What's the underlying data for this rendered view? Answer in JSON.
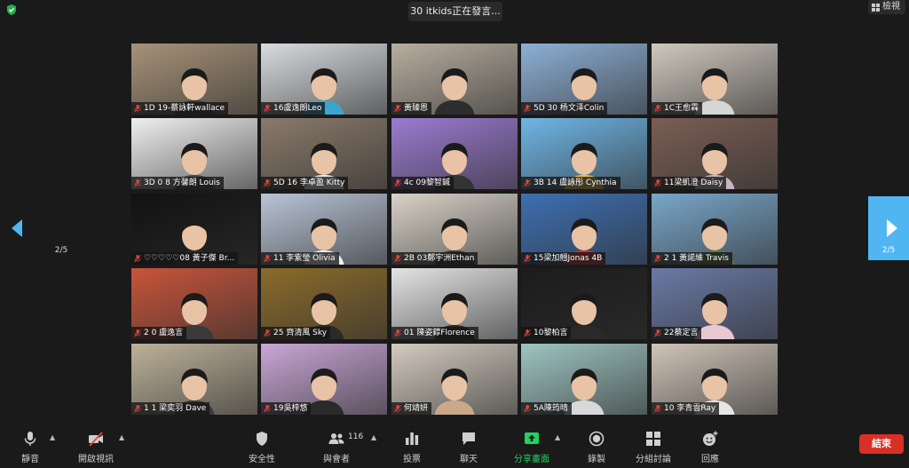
{
  "top": {
    "speaker_banner": "30 itkids正在發言...",
    "view_label": "檢視"
  },
  "pager": {
    "left": "2/5",
    "right": "2/5"
  },
  "colors": {
    "accent_blue": "#4fb6f2",
    "end_red": "#d93025",
    "share_green": "#23d160",
    "mic_muted": "#e5463b"
  },
  "tiles": [
    {
      "name": "1D 19-蔡詠軒wallace",
      "scene": "#a79278",
      "shirt": "#3a3a3a"
    },
    {
      "name": "16盧逸朗Leo",
      "scene": "#d9dce0",
      "shirt": "#39a6cf"
    },
    {
      "name": "黃臻恩",
      "scene": "#b8aea0",
      "shirt": "#2d2d2d"
    },
    {
      "name": "5D 30 杨文泽Colin",
      "scene": "#8db0d6",
      "shirt": "#5a5a5a"
    },
    {
      "name": "1C王愈霖",
      "scene": "#cfc8be",
      "shirt": "#d6d6d6"
    },
    {
      "name": "3D 0 8 方馨朗 Louis",
      "scene": "#f0f0f0",
      "shirt": "#4a4a4a"
    },
    {
      "name": "5D 16 李卓盈 Kitty",
      "scene": "#8a7a6a",
      "shirt": "#efefef"
    },
    {
      "name": "4c 09黎智鍼",
      "scene": "#9b7bd1",
      "shirt": "#333333"
    },
    {
      "name": "3B 14 盧詠彤 Cynthia",
      "scene": "#6fb6e6",
      "shirt": "#e8c25a"
    },
    {
      "name": "11梁凱澄 Daisy",
      "scene": "#7a5e54",
      "shirt": "#c9b4c4"
    },
    {
      "name": "♡♡♡♡♡08 黃子傑 Br...",
      "scene": "#121212",
      "shirt": "#3a2a2a"
    },
    {
      "name": "11 李紫瑩 Olivia",
      "scene": "#b9c4d6",
      "shirt": "#f2f2f2"
    },
    {
      "name": "2B 03鄭宇洲Ethan",
      "scene": "#d9d2c8",
      "shirt": "#3a3a3a"
    },
    {
      "name": "15梁加翹Jonas 4B",
      "scene": "#3d6fb2",
      "shirt": "#c33"
    },
    {
      "name": "2 1 黃諾維 Travis",
      "scene": "#79a6c9",
      "shirt": "#5a7a4a"
    },
    {
      "name": "2 0 盧逸言",
      "scene": "#c8543a",
      "shirt": "#3a3a3a"
    },
    {
      "name": "25 齊清風 Sky",
      "scene": "#8b6b2a",
      "shirt": "#2a2a2a"
    },
    {
      "name": "01 陳姿錞Florence",
      "scene": "#e4e4e4",
      "shirt": "#2a2a2a"
    },
    {
      "name": "10黎柏言",
      "scene": "#1c1c1c",
      "shirt": "#2a2a2a"
    },
    {
      "name": "22蔡定言",
      "scene": "#6a7aa6",
      "shirt": "#e9c8d2"
    },
    {
      "name": "1 1 梁奕羽 Dave",
      "scene": "#bdb29a",
      "shirt": "#3a3a3a"
    },
    {
      "name": "19吳梓悠",
      "scene": "#c9a7d6",
      "shirt": "#2a2a2a"
    },
    {
      "name": "何靖妍",
      "scene": "#d4cbc0",
      "shirt": "#caa88a"
    },
    {
      "name": "5A陳筠晴",
      "scene": "#9ec5c2",
      "shirt": "#d8d8d8"
    },
    {
      "name": "10 李青雲Ray",
      "scene": "#cfc4b8",
      "shirt": "#e6e6e6"
    }
  ],
  "toolbar": {
    "mute": "靜音",
    "video": "開啟視訊",
    "security": "安全性",
    "participants": "與會者",
    "participant_count": "116",
    "poll": "投票",
    "chat": "聊天",
    "share": "分享畫面",
    "record": "錄製",
    "breakout": "分組討論",
    "reactions": "回應",
    "end": "結束"
  }
}
